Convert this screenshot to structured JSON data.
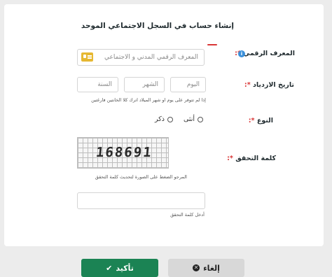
{
  "form": {
    "title": "إنشاء حساب في السجل الاجتماعي الموحد",
    "national_id": {
      "label": "المعرف الرقمي",
      "required_mark": "*:",
      "placeholder": "المعرف الرقمي المدني و الاجتماعي",
      "info_icon": "i"
    },
    "birth_date": {
      "label": "تاريخ الازدياد",
      "required_mark": "*:",
      "day_placeholder": "اليوم",
      "month_placeholder": "الشهر",
      "year_placeholder": "السنة",
      "hint": "إذا لم تتوفر على يوم او شهر الميلاد اترك كلا الخانتين فارغتين"
    },
    "gender": {
      "label": "النوع",
      "required_mark": "*:",
      "female": "أنثى",
      "male": "ذكر"
    },
    "captcha": {
      "label": "كلمة التحقق",
      "required_mark": "*:",
      "code": "168691",
      "refresh_hint": "المرجو الضغط على الصورة لتحديث كلمة التحقق",
      "input_hint": "أدخل كلمة التحقق"
    }
  },
  "buttons": {
    "confirm": "تأكيد",
    "cancel": "إلغاء"
  },
  "colors": {
    "primary": "#1b8354",
    "required": "#d93636",
    "info": "#3a8fd9"
  }
}
